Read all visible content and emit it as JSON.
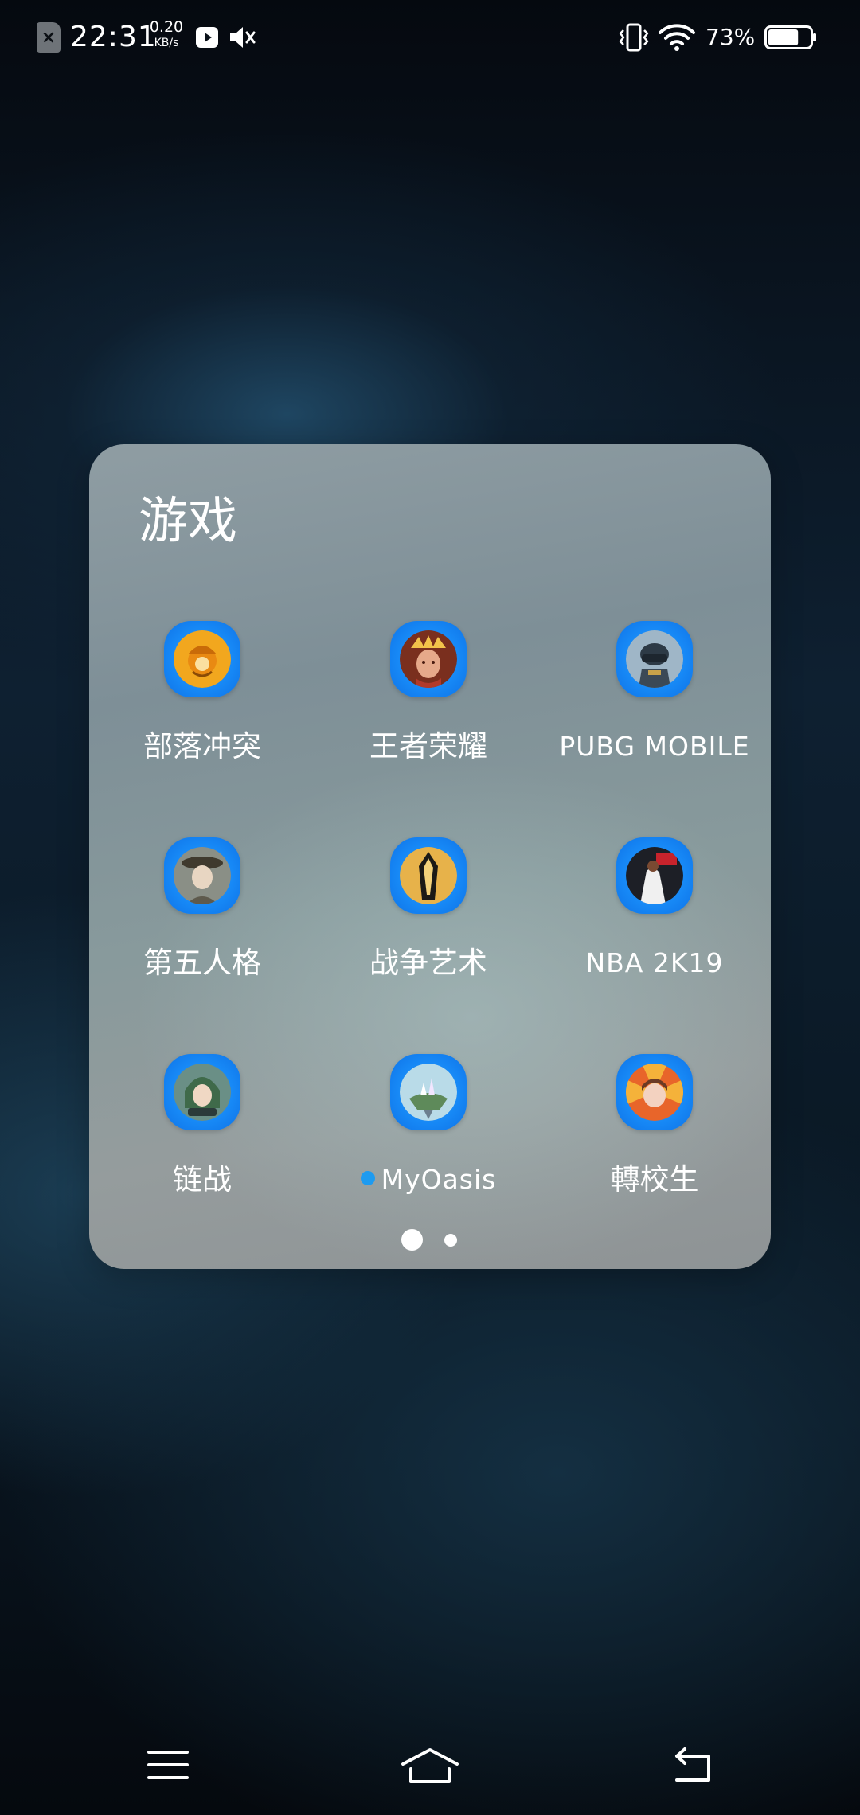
{
  "status_bar": {
    "time": "22:31",
    "net_speed_value": "0.20",
    "net_speed_unit": "KB/s",
    "battery_percent": "73%",
    "battery_level": 0.73,
    "icons": [
      "sim-card-none-icon",
      "video-play-icon",
      "muted-speaker-icon",
      "vibrate-icon",
      "wifi-icon",
      "battery-icon"
    ]
  },
  "folder": {
    "title": "游戏",
    "apps": [
      {
        "label": "部落冲突",
        "icon": "clash-of-clans-icon",
        "new": false
      },
      {
        "label": "王者荣耀",
        "icon": "honor-of-kings-icon",
        "new": false
      },
      {
        "label": "PUBG MOBILE",
        "icon": "pubg-mobile-icon",
        "new": false
      },
      {
        "label": "第五人格",
        "icon": "identity-v-icon",
        "new": false
      },
      {
        "label": "战争艺术",
        "icon": "art-of-war-icon",
        "new": false
      },
      {
        "label": "NBA 2K19",
        "icon": "nba-2k19-icon",
        "new": false
      },
      {
        "label": "链战",
        "icon": "chain-war-icon",
        "new": false
      },
      {
        "label": "MyOasis",
        "icon": "myoasis-icon",
        "new": true
      },
      {
        "label": "轉校生",
        "icon": "transfer-student-icon",
        "new": false
      }
    ],
    "page_count": 2,
    "current_page": 1
  },
  "nav_bar": {
    "icons": [
      "menu-icon",
      "home-icon",
      "back-icon"
    ]
  },
  "colors": {
    "app_badge_blue": "#1687f5",
    "new_dot": "#1e9bf0",
    "folder_bg": "#8a999d"
  }
}
